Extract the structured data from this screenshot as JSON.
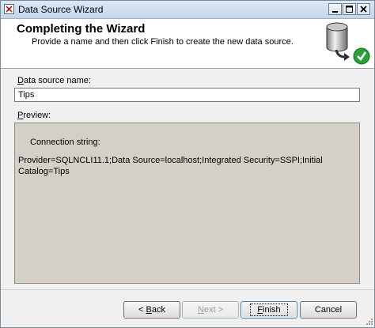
{
  "window": {
    "title": "Data Source Wizard"
  },
  "header": {
    "title": "Completing the Wizard",
    "subtitle": "Provide a name and then click Finish to create the new data source.",
    "icon": "database-check-icon"
  },
  "form": {
    "name_label_access": "D",
    "name_label_rest": "ata source name:",
    "name_value": "Tips",
    "preview_label_access": "P",
    "preview_label_rest": "review:"
  },
  "preview": {
    "heading": "Connection string:",
    "body": "Provider=SQLNCLI11.1;Data Source=localhost;Integrated Security=SSPI;Initial Catalog=Tips"
  },
  "buttons": {
    "back_prefix": "< ",
    "back_access": "B",
    "back_rest": "ack",
    "next_access": "N",
    "next_rest": "ext >",
    "finish_access": "F",
    "finish_rest": "inish",
    "cancel": "Cancel"
  },
  "colors": {
    "accent": "#2aa038",
    "preview_bg": "#d4d0c8"
  }
}
